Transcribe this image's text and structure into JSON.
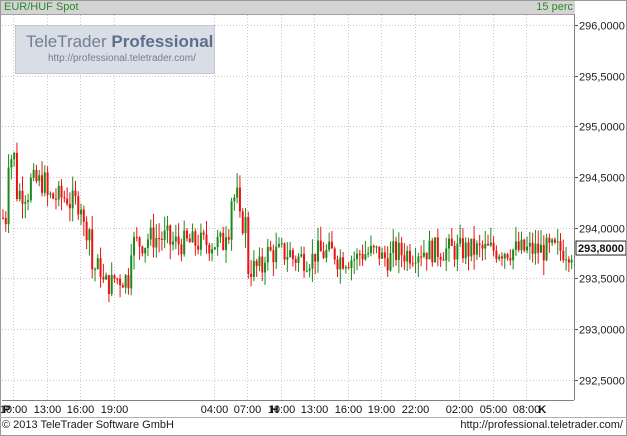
{
  "header": {
    "title": "EUR/HUF Spot",
    "interval": "15 perc"
  },
  "watermark": {
    "brand": "TeleTrader",
    "brand_bold": "Professional",
    "url": "http://professional.teletrader.com/"
  },
  "footer": {
    "copyright": "© 2013 TeleTrader Software GmbH",
    "url": "http://professional.teletrader.com/"
  },
  "colors": {
    "up": "#1a8a1a",
    "down": "#ee1111",
    "grid": "#c8c8c8",
    "accent": "#2a8a2a"
  },
  "chart_data": {
    "type": "candlestick",
    "title": "EUR/HUF Spot",
    "interval": "15 perc",
    "y_axis": {
      "position": "right",
      "ylim": [
        292.3,
        296.1
      ],
      "ticks": [
        292.5,
        293.0,
        293.5,
        294.0,
        294.5,
        295.0,
        295.5,
        296.0
      ],
      "tick_labels": [
        "292,5000",
        "293,0000",
        "293,5000",
        "294,0000",
        "294,5000",
        "295,0000",
        "295,5000",
        "296,0000"
      ]
    },
    "x_axis": {
      "day_markers": [
        {
          "label": "P",
          "slot": 0
        },
        {
          "label": "H",
          "slot": 24
        },
        {
          "label": "K",
          "slot": 48
        }
      ],
      "time_ticks": [
        {
          "label": "10:00",
          "slot": 1
        },
        {
          "label": "13:00",
          "slot": 4
        },
        {
          "label": "16:00",
          "slot": 7
        },
        {
          "label": "19:00",
          "slot": 10
        },
        {
          "label": "04:00",
          "slot": 19
        },
        {
          "label": "07:00",
          "slot": 22
        },
        {
          "label": "10:00",
          "slot": 25
        },
        {
          "label": "13:00",
          "slot": 28
        },
        {
          "label": "16:00",
          "slot": 31
        },
        {
          "label": "19:00",
          "slot": 34
        },
        {
          "label": "22:00",
          "slot": 37
        },
        {
          "label": "02:00",
          "slot": 41
        },
        {
          "label": "05:00",
          "slot": 44
        },
        {
          "label": "08:00",
          "slot": 47
        }
      ],
      "slots_total": 51.3
    },
    "last_value": 293.8,
    "last_value_label": "293,8000",
    "grid": true,
    "segments": [
      {
        "start_slot": 0,
        "end_slot": 0.5,
        "level": 294.1
      },
      {
        "start_slot": 0.5,
        "end_slot": 1.2,
        "level": 294.7
      },
      {
        "start_slot": 1.2,
        "end_slot": 2.5,
        "level": 294.35
      },
      {
        "start_slot": 2.5,
        "end_slot": 4.0,
        "level": 294.45
      },
      {
        "start_slot": 4.0,
        "end_slot": 6.0,
        "level": 294.3
      },
      {
        "start_slot": 6.0,
        "end_slot": 7.2,
        "level": 294.25
      },
      {
        "start_slot": 7.2,
        "end_slot": 8.0,
        "level": 294.0
      },
      {
        "start_slot": 8.0,
        "end_slot": 8.8,
        "level": 293.6
      },
      {
        "start_slot": 8.8,
        "end_slot": 10.0,
        "level": 293.45
      },
      {
        "start_slot": 10.0,
        "end_slot": 11.3,
        "level": 293.5
      },
      {
        "start_slot": 11.3,
        "end_slot": 13.0,
        "level": 293.85
      },
      {
        "start_slot": 13.0,
        "end_slot": 15.0,
        "level": 293.9
      },
      {
        "start_slot": 15.0,
        "end_slot": 18.5,
        "level": 293.85
      },
      {
        "start_slot": 18.5,
        "end_slot": 19.8,
        "level": 293.85
      },
      {
        "start_slot": 19.8,
        "end_slot": 20.3,
        "level": 294.0
      },
      {
        "start_slot": 20.3,
        "end_slot": 21.2,
        "level": 294.3
      },
      {
        "start_slot": 21.2,
        "end_slot": 22.0,
        "level": 294.05
      },
      {
        "start_slot": 22.0,
        "end_slot": 23.5,
        "level": 293.6
      },
      {
        "start_slot": 23.5,
        "end_slot": 26.0,
        "level": 293.75
      },
      {
        "start_slot": 26.0,
        "end_slot": 28.0,
        "level": 293.7
      },
      {
        "start_slot": 28.0,
        "end_slot": 30.0,
        "level": 293.75
      },
      {
        "start_slot": 30.0,
        "end_slot": 32.0,
        "level": 293.7
      },
      {
        "start_slot": 32.0,
        "end_slot": 34.0,
        "level": 293.75
      },
      {
        "start_slot": 34.0,
        "end_slot": 35.0,
        "level": 293.7
      },
      {
        "start_slot": 35.0,
        "end_slot": 37.0,
        "level": 293.75
      },
      {
        "start_slot": 37.0,
        "end_slot": 51.2,
        "level": 293.78
      }
    ]
  }
}
